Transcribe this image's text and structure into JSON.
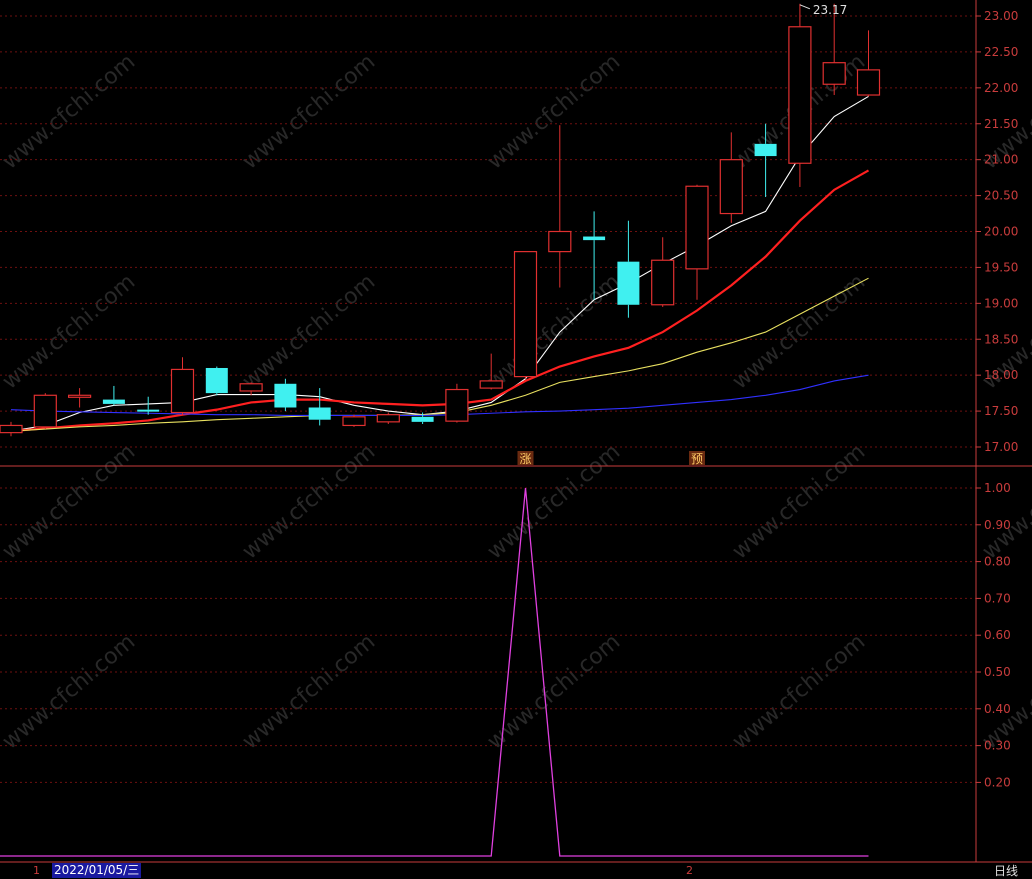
{
  "chart_data": [
    {
      "type": "candlestick",
      "title": "",
      "ylim": [
        16.8,
        23.2
      ],
      "y_ticks": [
        "23.00",
        "22.50",
        "22.00",
        "21.50",
        "21.00",
        "20.50",
        "20.00",
        "19.50",
        "19.00",
        "18.50",
        "18.00",
        "17.50",
        "17.00"
      ],
      "candles": [
        {
          "o": 17.2,
          "h": 17.35,
          "l": 17.15,
          "c": 17.3
        },
        {
          "o": 17.28,
          "h": 17.75,
          "l": 17.25,
          "c": 17.72
        },
        {
          "o": 17.7,
          "h": 17.82,
          "l": 17.55,
          "c": 17.72
        },
        {
          "o": 17.66,
          "h": 17.85,
          "l": 17.58,
          "c": 17.6
        },
        {
          "o": 17.52,
          "h": 17.7,
          "l": 17.45,
          "c": 17.5
        },
        {
          "o": 17.48,
          "h": 18.25,
          "l": 17.45,
          "c": 18.08
        },
        {
          "o": 18.1,
          "h": 18.12,
          "l": 17.72,
          "c": 17.75
        },
        {
          "o": 17.78,
          "h": 17.9,
          "l": 17.72,
          "c": 17.88
        },
        {
          "o": 17.88,
          "h": 17.95,
          "l": 17.5,
          "c": 17.55
        },
        {
          "o": 17.55,
          "h": 17.82,
          "l": 17.3,
          "c": 17.38
        },
        {
          "o": 17.3,
          "h": 17.45,
          "l": 17.28,
          "c": 17.42
        },
        {
          "o": 17.35,
          "h": 17.48,
          "l": 17.32,
          "c": 17.45
        },
        {
          "o": 17.42,
          "h": 17.48,
          "l": 17.32,
          "c": 17.35
        },
        {
          "o": 17.36,
          "h": 17.88,
          "l": 17.34,
          "c": 17.8
        },
        {
          "o": 17.82,
          "h": 18.3,
          "l": 17.8,
          "c": 17.92
        },
        {
          "o": 17.98,
          "h": 19.72,
          "l": 17.95,
          "c": 19.72
        },
        {
          "o": 19.72,
          "h": 21.48,
          "l": 19.22,
          "c": 20.0
        },
        {
          "o": 19.93,
          "h": 20.28,
          "l": 19.05,
          "c": 19.88
        },
        {
          "o": 19.58,
          "h": 20.15,
          "l": 18.8,
          "c": 18.98
        },
        {
          "o": 18.98,
          "h": 19.92,
          "l": 18.95,
          "c": 19.6
        },
        {
          "o": 19.48,
          "h": 20.65,
          "l": 19.05,
          "c": 20.63
        },
        {
          "o": 20.25,
          "h": 21.38,
          "l": 20.12,
          "c": 21.0
        },
        {
          "o": 21.22,
          "h": 21.5,
          "l": 20.48,
          "c": 21.05
        },
        {
          "o": 20.95,
          "h": 23.17,
          "l": 20.62,
          "c": 22.85
        },
        {
          "o": 22.05,
          "h": 23.17,
          "l": 21.9,
          "c": 22.35
        },
        {
          "o": 21.9,
          "h": 22.8,
          "l": 21.88,
          "c": 22.25
        }
      ],
      "series": [
        {
          "color": "#ffffff",
          "values": [
            17.22,
            17.3,
            17.48,
            17.58,
            17.6,
            17.62,
            17.73,
            17.73,
            17.73,
            17.7,
            17.58,
            17.5,
            17.45,
            17.5,
            17.62,
            17.95,
            18.6,
            19.05,
            19.28,
            19.55,
            19.8,
            20.08,
            20.28,
            21.05,
            21.6,
            21.88
          ]
        },
        {
          "color": "#ff2020",
          "values": [
            17.22,
            17.26,
            17.3,
            17.33,
            17.37,
            17.45,
            17.52,
            17.62,
            17.66,
            17.66,
            17.62,
            17.6,
            17.58,
            17.6,
            17.66,
            17.92,
            18.12,
            18.26,
            18.38,
            18.6,
            18.9,
            19.25,
            19.65,
            20.15,
            20.58,
            20.85
          ]
        },
        {
          "color": "#e8e060",
          "values": [
            17.22,
            17.25,
            17.28,
            17.3,
            17.33,
            17.35,
            17.38,
            17.4,
            17.42,
            17.44,
            17.44,
            17.44,
            17.45,
            17.48,
            17.58,
            17.72,
            17.9,
            17.98,
            18.06,
            18.16,
            18.32,
            18.45,
            18.6,
            18.85,
            19.1,
            19.35
          ]
        },
        {
          "color": "#3030ff",
          "values": [
            17.52,
            17.5,
            17.49,
            17.48,
            17.47,
            17.46,
            17.45,
            17.45,
            17.44,
            17.44,
            17.44,
            17.44,
            17.44,
            17.45,
            17.47,
            17.49,
            17.5,
            17.52,
            17.54,
            17.58,
            17.62,
            17.66,
            17.72,
            17.8,
            17.92,
            18.0
          ]
        }
      ],
      "high_label": "23.17",
      "signal_marks": [
        {
          "index": 15,
          "text": "涨"
        },
        {
          "index": 20,
          "text": "预"
        }
      ]
    },
    {
      "type": "line",
      "title": "",
      "ylim": [
        0.0,
        1.03
      ],
      "y_ticks": [
        "1.00",
        "0.90",
        "0.80",
        "0.70",
        "0.60",
        "0.50",
        "0.40",
        "0.30",
        "0.20"
      ],
      "series": [
        {
          "color": "#e040e0",
          "values": [
            0,
            0,
            0,
            0,
            0,
            0,
            0,
            0,
            0,
            0,
            0,
            0,
            0,
            0,
            0,
            1,
            0,
            0,
            0,
            0,
            0,
            0,
            0,
            0,
            0,
            0
          ]
        }
      ]
    }
  ],
  "watermark": "www.cfchi.com",
  "date_label": "2022/01/05/三",
  "period_label": "日线",
  "axis_marks": [
    "1",
    "2"
  ],
  "colors": {
    "up": "#e03030",
    "down": "#40f0f0",
    "grid": "#6e1010",
    "axis": "#c83c3c"
  }
}
